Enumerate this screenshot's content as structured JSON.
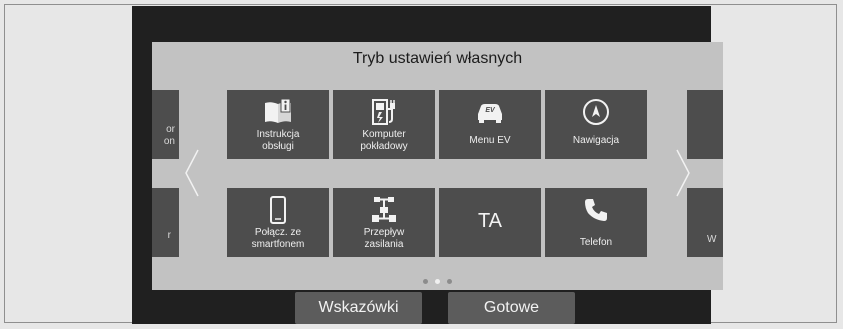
{
  "title": "Tryb ustawień własnych",
  "tiles": [
    {
      "label": "Instrukcja\nobsługi",
      "icon": "book-info-icon"
    },
    {
      "label": "Komputer\npokładowy",
      "icon": "ev-charge-icon"
    },
    {
      "label": "Menu EV",
      "icon": "ev-car-icon"
    },
    {
      "label": "Nawigacja",
      "icon": "compass-icon"
    },
    {
      "label": "Połącz. ze\nsmartfonem",
      "icon": "smartphone-icon"
    },
    {
      "label": "Przepływ\nzasilania",
      "icon": "power-flow-icon"
    },
    {
      "label": "TA",
      "icon": "ta-text"
    },
    {
      "label": "Telefon",
      "icon": "phone-icon"
    }
  ],
  "edge_left": {
    "top": "or\non",
    "bottom": "r"
  },
  "edge_right": {
    "bottom": "W"
  },
  "pagination": {
    "pages": 3,
    "active": 2
  },
  "buttons": {
    "hints": "Wskazówki",
    "done": "Gotowe"
  },
  "colors": {
    "tile": "#4d4d4d",
    "panel": "#c2c2c2",
    "screen": "#202020",
    "button": "#5c5c5c"
  }
}
